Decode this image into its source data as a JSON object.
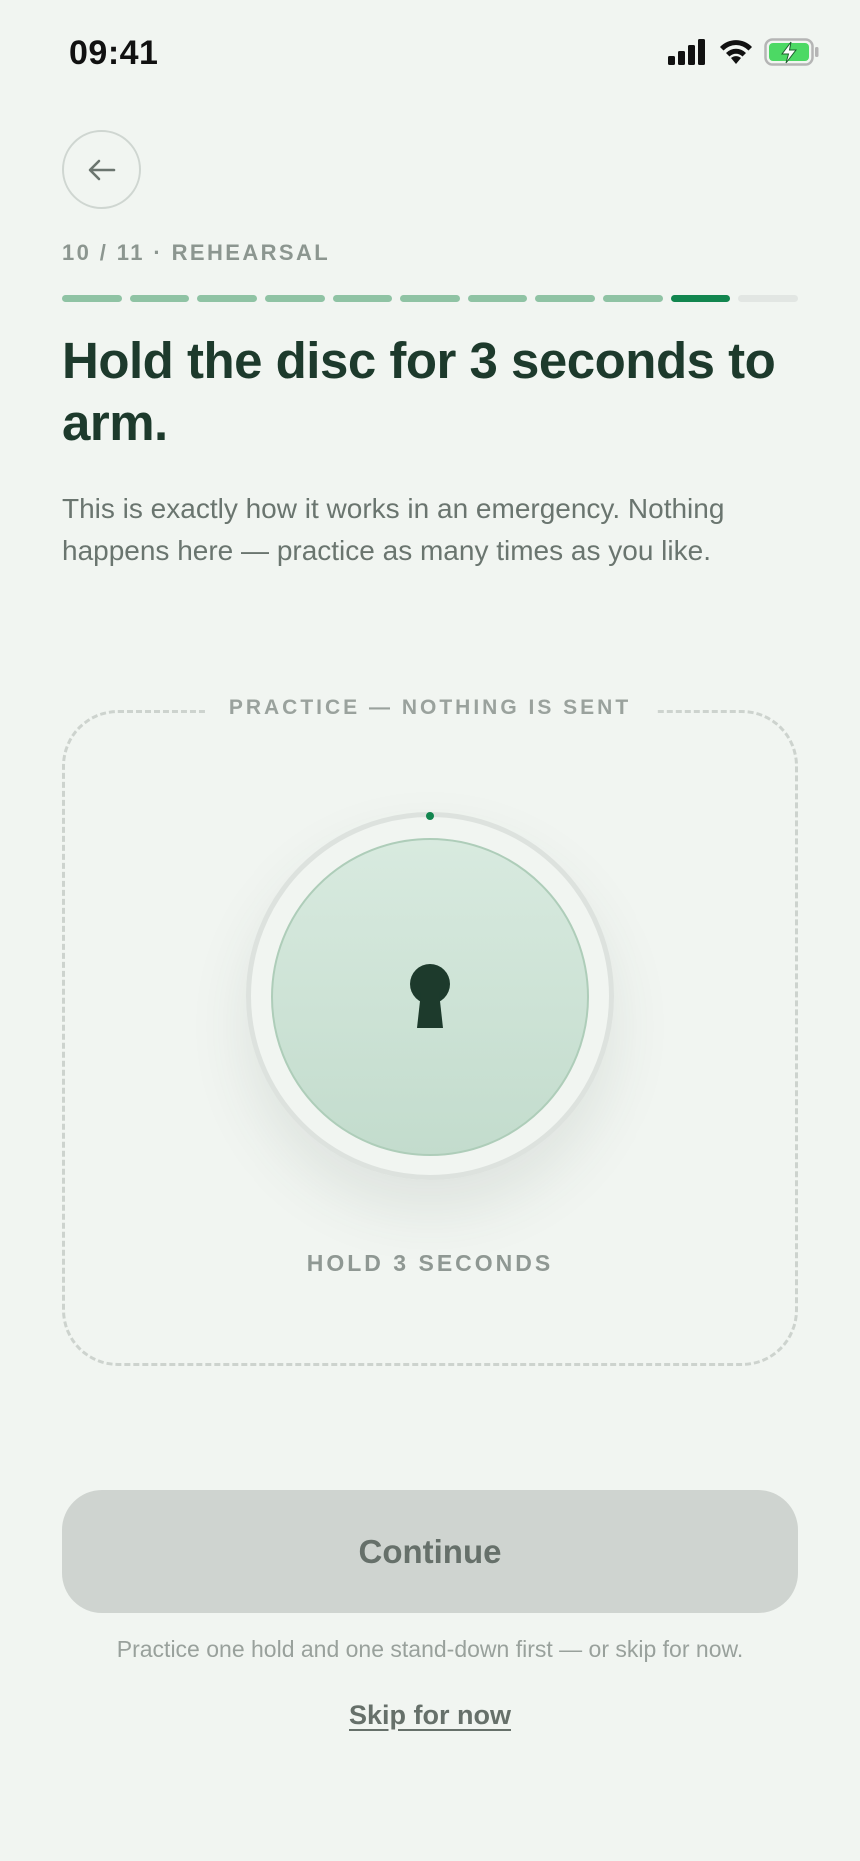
{
  "status_bar": {
    "time": "09:41",
    "icons": [
      "signal-icon",
      "wifi-icon",
      "battery-charging-icon"
    ]
  },
  "header": {
    "back_icon": "arrow-left-icon",
    "step_label": "10 / 11 · REHEARSAL",
    "progress": {
      "current_step": 10,
      "total_steps": 11
    }
  },
  "main": {
    "title": "Hold the disc for 3 seconds to arm.",
    "subtitle": "This is exactly how it works in an emergency. Nothing happens here — practice as many times as you like."
  },
  "practice": {
    "caption": "PRACTICE — NOTHING IS SENT",
    "disc_icon": "keyhole-icon",
    "hold_label": "HOLD 3 SECONDS",
    "hold_progress": 0
  },
  "footer": {
    "continue_label": "Continue",
    "helper_text": "Practice one hold and one stand-down first — or skip for now.",
    "skip_label": "Skip for now"
  },
  "colors": {
    "background": "#f1f5f1",
    "accent": "#12864f",
    "progress_done": "#8fc3a4",
    "progress_todo": "#e2e6e3",
    "title_text": "#1d3a2c",
    "disc_fill": "#c8dfd0",
    "button_disabled": "#cfd4d0",
    "battery": "#4cd964"
  }
}
